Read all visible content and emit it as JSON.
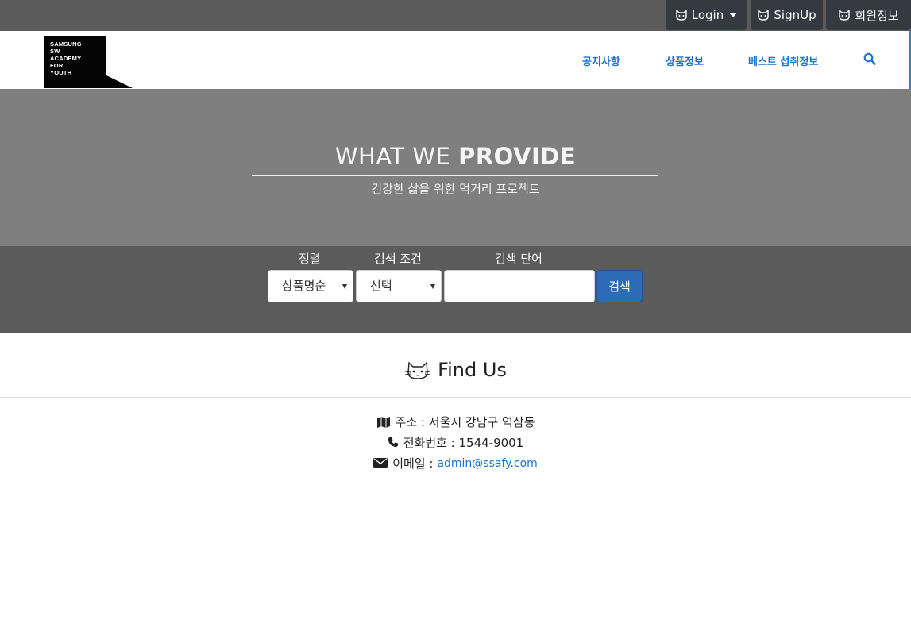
{
  "topbar": {
    "login_label": "Login",
    "signup_label": "SignUp",
    "member_label": "회원정보"
  },
  "logo": {
    "lines": [
      "SAMSUNG",
      "SW",
      "ACADEMY",
      "FOR",
      "YOUTH"
    ]
  },
  "nav": {
    "items": [
      {
        "label": "공지사항"
      },
      {
        "label": "상품정보"
      },
      {
        "label": "베스트 섭취정보"
      }
    ]
  },
  "hero": {
    "title_light": "WHAT WE ",
    "title_bold": "PROVIDE",
    "subtitle": "건강한 삶을 위한 먹거리 프로젝트"
  },
  "search": {
    "sort_label": "정렬",
    "condition_label": "검색 조건",
    "keyword_label": "검색 단어",
    "sort_value": "상품명순",
    "condition_value": "선택",
    "keyword_value": "",
    "button_label": "검색"
  },
  "find_us": {
    "title": "Find Us",
    "address_label": "주소 : 서울시 강남구 역삼동",
    "phone_label": "전화번호 : 1544-9001",
    "email_prefix": "이메일 :",
    "email": "admin@ssafy.com"
  },
  "colors": {
    "topbar_bg": "#5b5b5b",
    "button_dark": "#343a40",
    "nav_link": "#1a73d0",
    "hero_bg": "#7f7f7f",
    "search_button": "#2c6bb5"
  }
}
